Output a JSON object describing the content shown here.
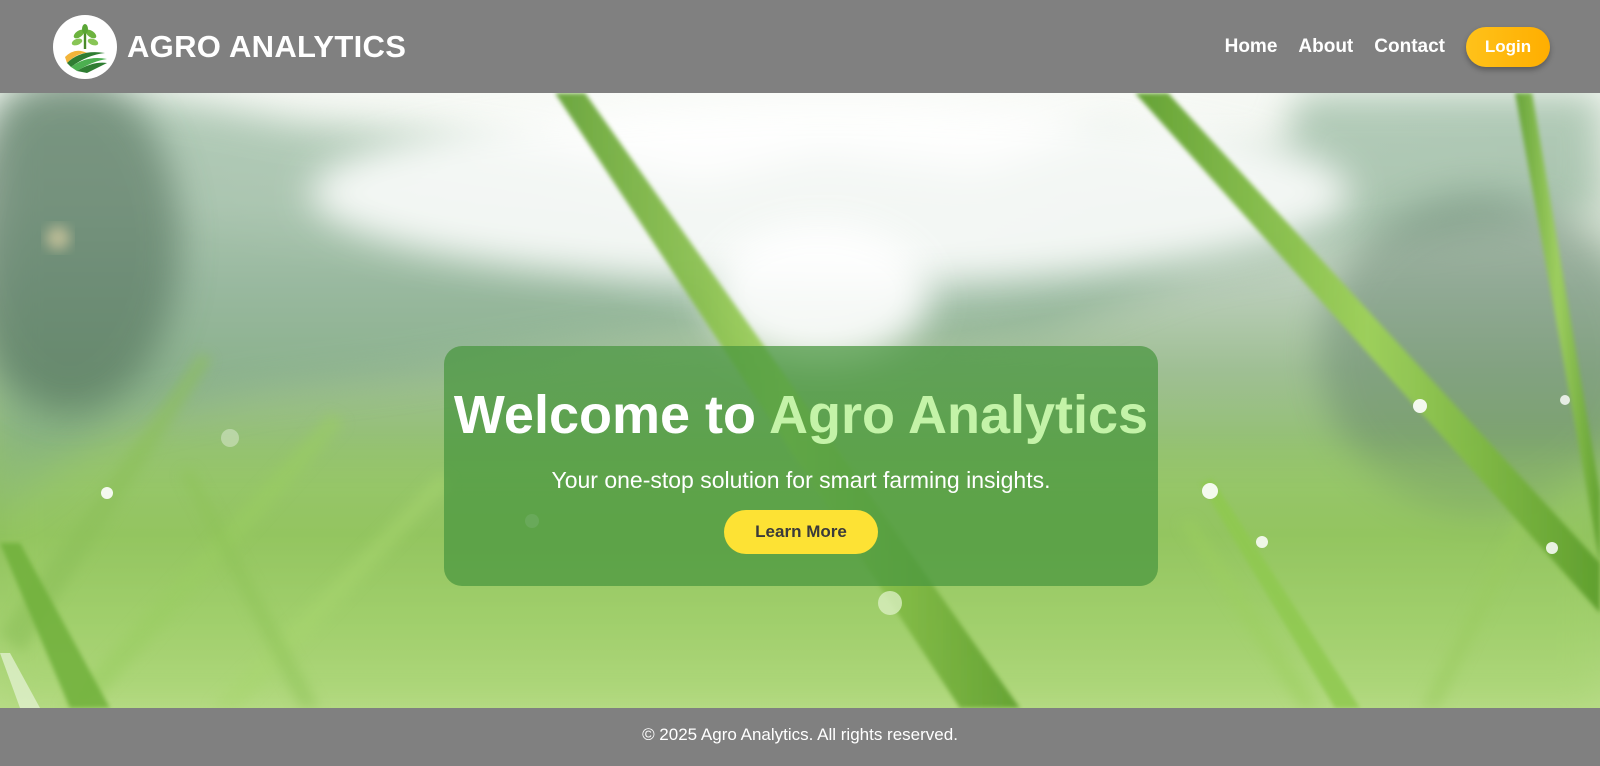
{
  "header": {
    "brand_name": "AGRO ANALYTICS",
    "logo_icon": "agro-leaf-field-logo",
    "nav": [
      {
        "label": "Home"
      },
      {
        "label": "About"
      },
      {
        "label": "Contact"
      }
    ],
    "login_label": "Login"
  },
  "hero": {
    "background": "dewy-grass-blades-photo",
    "title_prefix": "Welcome to",
    "title_accent": "Agro Analytics",
    "subtitle": "Your one-stop solution for smart farming insights.",
    "cta_label": "Learn More"
  },
  "footer": {
    "text": "© 2025 Agro Analytics. All rights reserved."
  },
  "colors": {
    "bar": "#808080",
    "login": "#ffb800",
    "card": "#48963e",
    "accent_text": "#c4f3a8",
    "cta": "#fde234"
  }
}
